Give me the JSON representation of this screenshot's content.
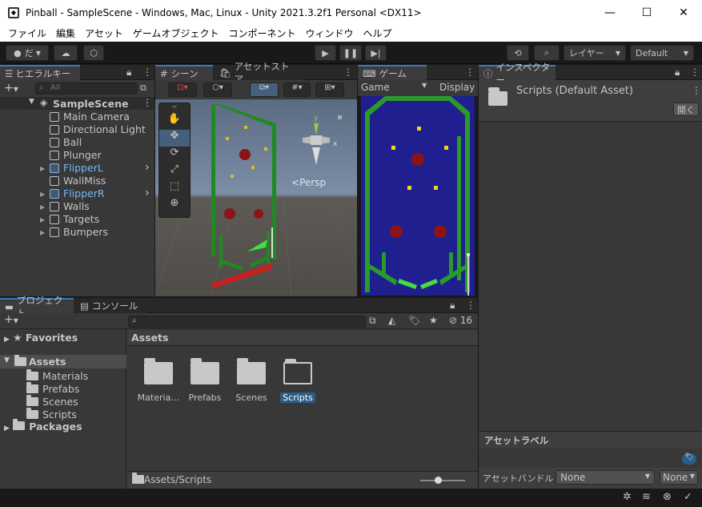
{
  "window": {
    "title": "Pinball - SampleScene - Windows, Mac, Linux - Unity 2021.3.2f1 Personal <DX11>",
    "minimize": "—",
    "maximize": "☐",
    "close": "✕"
  },
  "menu": [
    "ファイル",
    "編集",
    "アセット",
    "ゲームオブジェクト",
    "コンポーネント",
    "ウィンドウ",
    "ヘルプ"
  ],
  "toolbar": {
    "account_label": "だ",
    "layers_label": "レイヤー",
    "layout_label": "Default"
  },
  "hierarchy": {
    "tab_label": "ヒエラルキー",
    "search_placeholder": "All",
    "scene_name": "SampleScene",
    "items": [
      {
        "label": "Main Camera",
        "prefab": false,
        "expandable": false
      },
      {
        "label": "Directional Light",
        "prefab": false,
        "expandable": false
      },
      {
        "label": "Ball",
        "prefab": false,
        "expandable": false
      },
      {
        "label": "Plunger",
        "prefab": false,
        "expandable": false
      },
      {
        "label": "FlipperL",
        "prefab": true,
        "expandable": true
      },
      {
        "label": "WallMiss",
        "prefab": false,
        "expandable": false
      },
      {
        "label": "FlipperR",
        "prefab": true,
        "expandable": true
      },
      {
        "label": "Walls",
        "prefab": false,
        "expandable": true
      },
      {
        "label": "Targets",
        "prefab": false,
        "expandable": true
      },
      {
        "label": "Bumpers",
        "prefab": false,
        "expandable": true
      }
    ]
  },
  "scene_view": {
    "tab_scene": "シーン",
    "tab_asset_store": "アセットストア",
    "persp_label": "Persp",
    "gizmo_y": "y",
    "gizmo_x": "x"
  },
  "game_view": {
    "tab_label": "ゲーム",
    "display_mode": "Game",
    "display_label": "Display"
  },
  "inspector": {
    "tab_label": "インスペクター",
    "asset_title": "Scripts (Default Asset)",
    "open_button": "開く",
    "asset_labels_heading": "アセットラベル",
    "asset_bundle_label": "アセットバンドル",
    "bundle_value": "None",
    "variant_value": "None"
  },
  "project": {
    "tab_project": "プロジェクト",
    "tab_console": "コンソール",
    "hidden_count": "16",
    "tree": {
      "favorites": "Favorites",
      "assets": "Assets",
      "children": [
        "Materials",
        "Prefabs",
        "Scenes",
        "Scripts"
      ],
      "packages": "Packages"
    },
    "breadcrumb": "Assets",
    "grid_items": [
      {
        "label": "Materia…",
        "selected": false
      },
      {
        "label": "Prefabs",
        "selected": false
      },
      {
        "label": "Scenes",
        "selected": false
      },
      {
        "label": "Scripts",
        "selected": true
      }
    ],
    "path": "Assets/Scripts"
  },
  "colors": {
    "accent": "#3a79bb",
    "prefab_text": "#7cb6f5",
    "game_bg": "#1f1f8f",
    "wall_green": "#2a9a2a",
    "bumper_red": "#8b1414"
  }
}
